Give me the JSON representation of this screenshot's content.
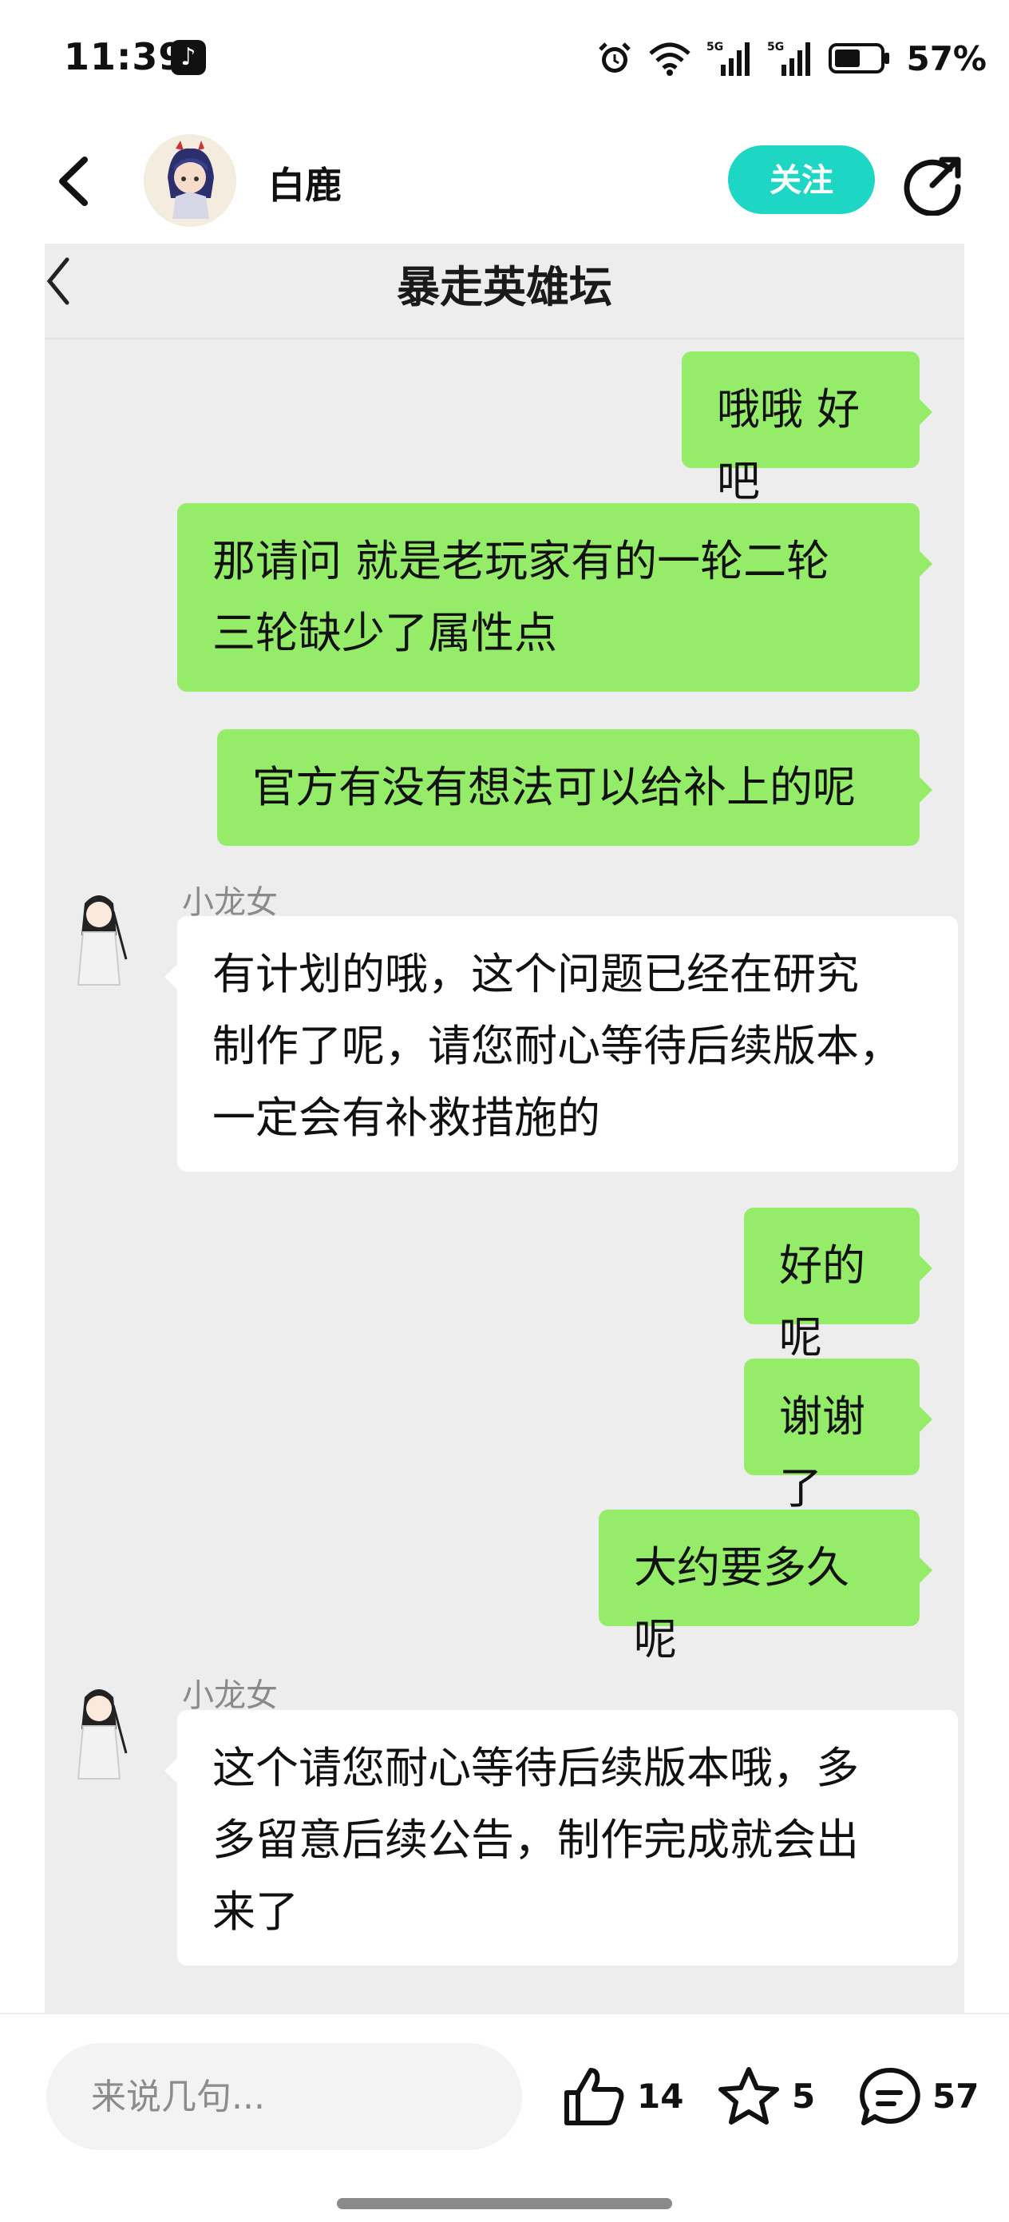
{
  "status_bar": {
    "time": "11:39",
    "app_icon": "tiktok-icon",
    "signal_label_1": "5G",
    "signal_label_2": "5G",
    "battery_percent": "57%",
    "battery_level": 0.57,
    "icons": [
      "alarm-icon",
      "wifi-icon",
      "signal-5g-icon",
      "signal-5g-icon",
      "battery-icon"
    ]
  },
  "header": {
    "username": "白鹿",
    "follow_label": "关注",
    "back_icon": "chevron-left-icon",
    "share_icon": "share-icon"
  },
  "chat": {
    "title": "暴走英雄坛",
    "messages": [
      {
        "side": "out",
        "lines": [
          "哦哦 好吧"
        ]
      },
      {
        "side": "out",
        "lines": [
          "那请问  就是老玩家有的一轮二轮",
          "三轮缺少了属性点"
        ]
      },
      {
        "side": "out",
        "lines": [
          "官方有没有想法可以给补上的呢"
        ]
      },
      {
        "side": "in",
        "sender": "小龙女",
        "lines": [
          "有计划的哦，这个问题已经在研究",
          "制作了呢，请您耐心等待后续版本，",
          "一定会有补救措施的"
        ]
      },
      {
        "side": "out",
        "lines": [
          "好的呢"
        ]
      },
      {
        "side": "out",
        "lines": [
          "谢谢了"
        ]
      },
      {
        "side": "out",
        "lines": [
          "大约要多久呢"
        ]
      },
      {
        "side": "in",
        "sender": "小龙女",
        "lines": [
          "这个请您耐心等待后续版本哦，多",
          "多留意后续公告，制作完成就会出",
          "来了"
        ]
      }
    ]
  },
  "bottom_bar": {
    "comment_placeholder": "来说几句...",
    "like_count": "14",
    "favorite_count": "5",
    "comment_count": "57",
    "accent_color": "#1ed6c4",
    "bubble_color": "#95ec69"
  }
}
